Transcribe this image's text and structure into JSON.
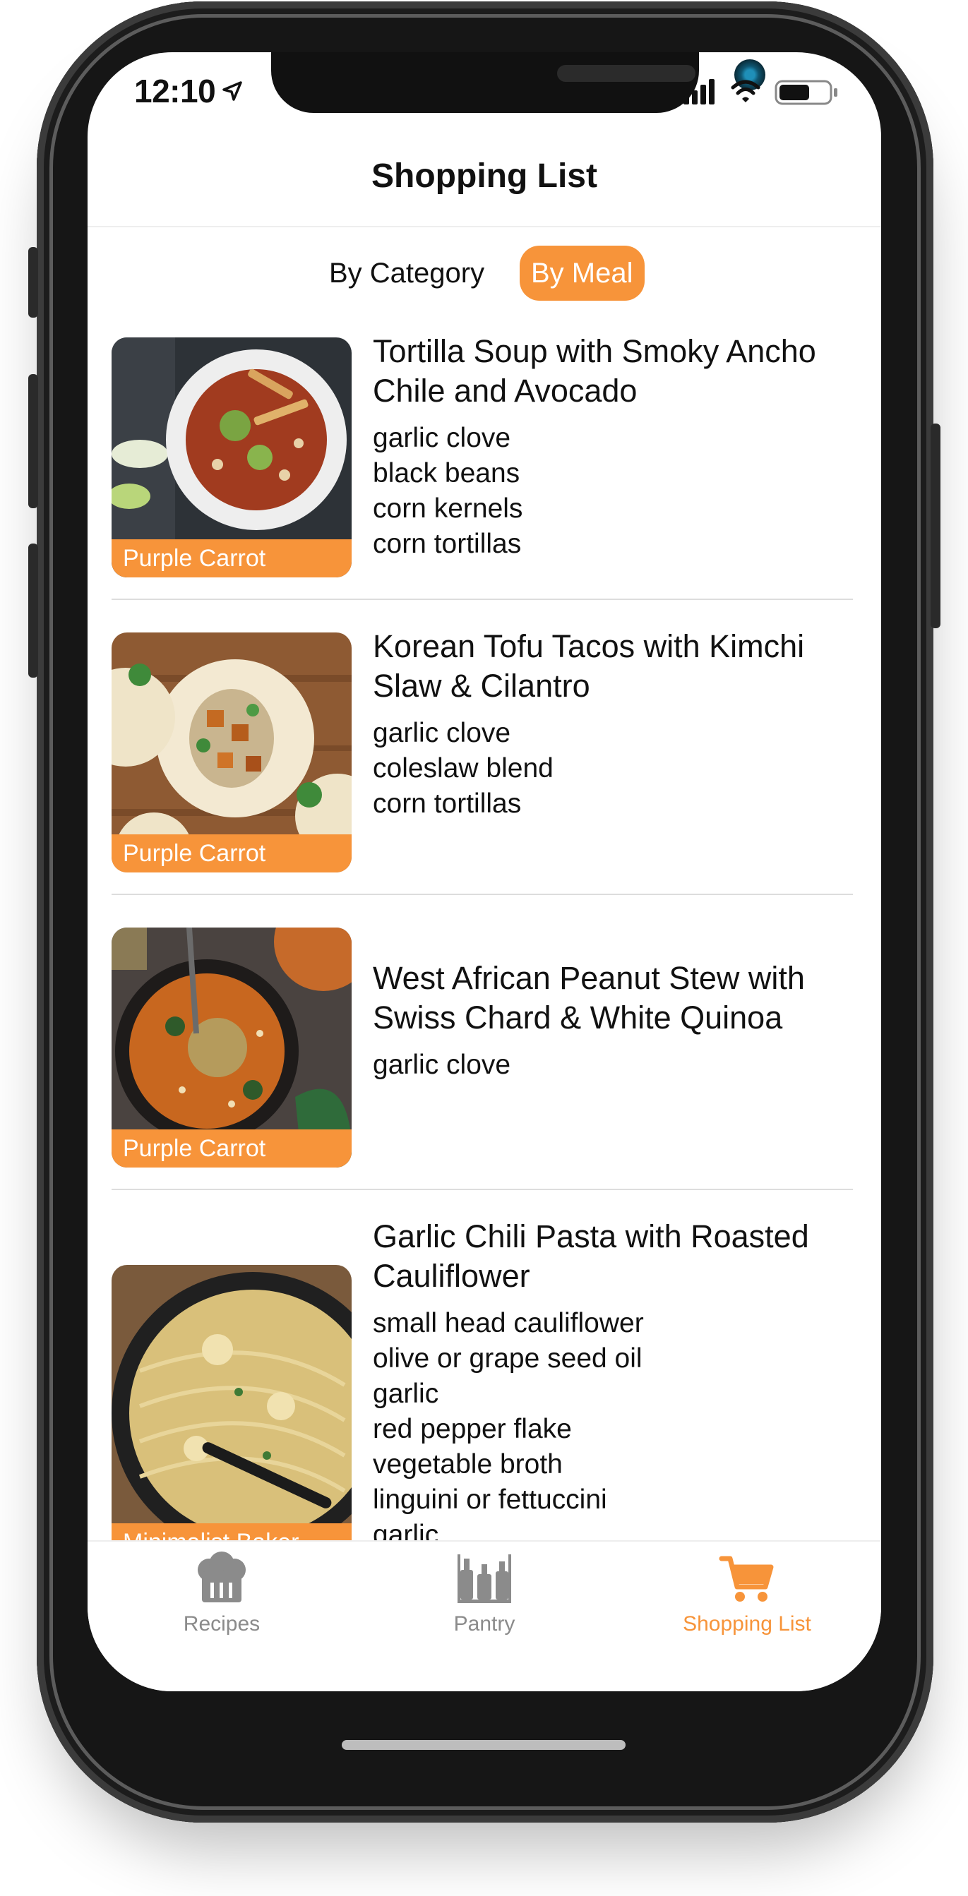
{
  "status_bar": {
    "time": "12:10"
  },
  "nav": {
    "title": "Shopping List"
  },
  "segments": [
    {
      "label": "By Category",
      "active": false
    },
    {
      "label": "By Meal",
      "active": true
    }
  ],
  "meals": [
    {
      "title_lines": [
        "Tortilla Soup with Smoky Ancho",
        "Chile and Avocado"
      ],
      "source": "Purple Carrot",
      "ingredients": [
        "garlic clove",
        "black beans",
        "corn kernels",
        "corn tortillas"
      ]
    },
    {
      "title_lines": [
        "Korean Tofu Tacos with Kimchi",
        "Slaw & Cilantro"
      ],
      "source": "Purple Carrot",
      "ingredients": [
        "garlic clove",
        "coleslaw blend",
        "corn tortillas"
      ]
    },
    {
      "title_lines": [
        "West African Peanut Stew with",
        "Swiss Chard & White Quinoa"
      ],
      "source": "Purple Carrot",
      "ingredients": [
        "garlic clove"
      ]
    },
    {
      "title_lines": [
        "Garlic Chili Pasta with Roasted",
        "Cauliflower"
      ],
      "source": "Minimalist Baker",
      "ingredients": [
        "small head cauliflower",
        "olive or grape seed oil",
        "garlic",
        "red pepper flake",
        "vegetable broth",
        "linguini or fettuccini",
        "garlic"
      ]
    }
  ],
  "tabs": [
    {
      "label": "Recipes",
      "icon": "chef-hat-icon",
      "active": false
    },
    {
      "label": "Pantry",
      "icon": "pantry-bottles-icon",
      "active": false
    },
    {
      "label": "Shopping List",
      "icon": "shopping-cart-icon",
      "active": true
    }
  ],
  "colors": {
    "accent": "#f7943a",
    "inactive": "#8b8b8b",
    "text": "#111111"
  }
}
